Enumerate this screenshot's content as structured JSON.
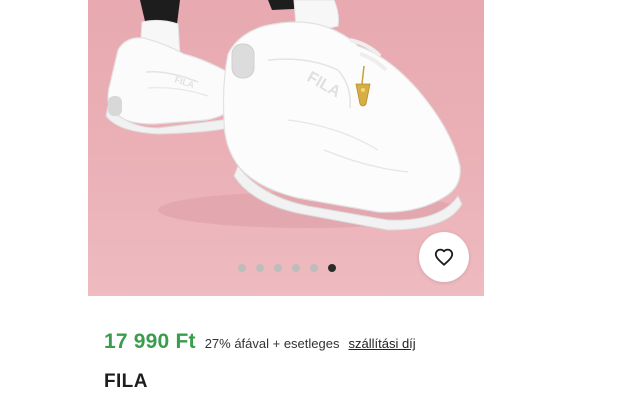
{
  "product": {
    "price": "17 990 Ft",
    "vat_note": "27% áfával + esetleges",
    "shipping_link": "szállítási díj",
    "brand": "FILA",
    "shoe_logo_text": "FILA"
  },
  "gallery": {
    "background_color": "#eab1b7",
    "slide_count": 6,
    "active_slide": 6
  },
  "wishlist": {
    "icon": "heart-outline-icon"
  },
  "colors": {
    "price": "#3a9d4c",
    "active_dot": "#2b2b2b",
    "inactive_dot": "#bdbdbd"
  }
}
